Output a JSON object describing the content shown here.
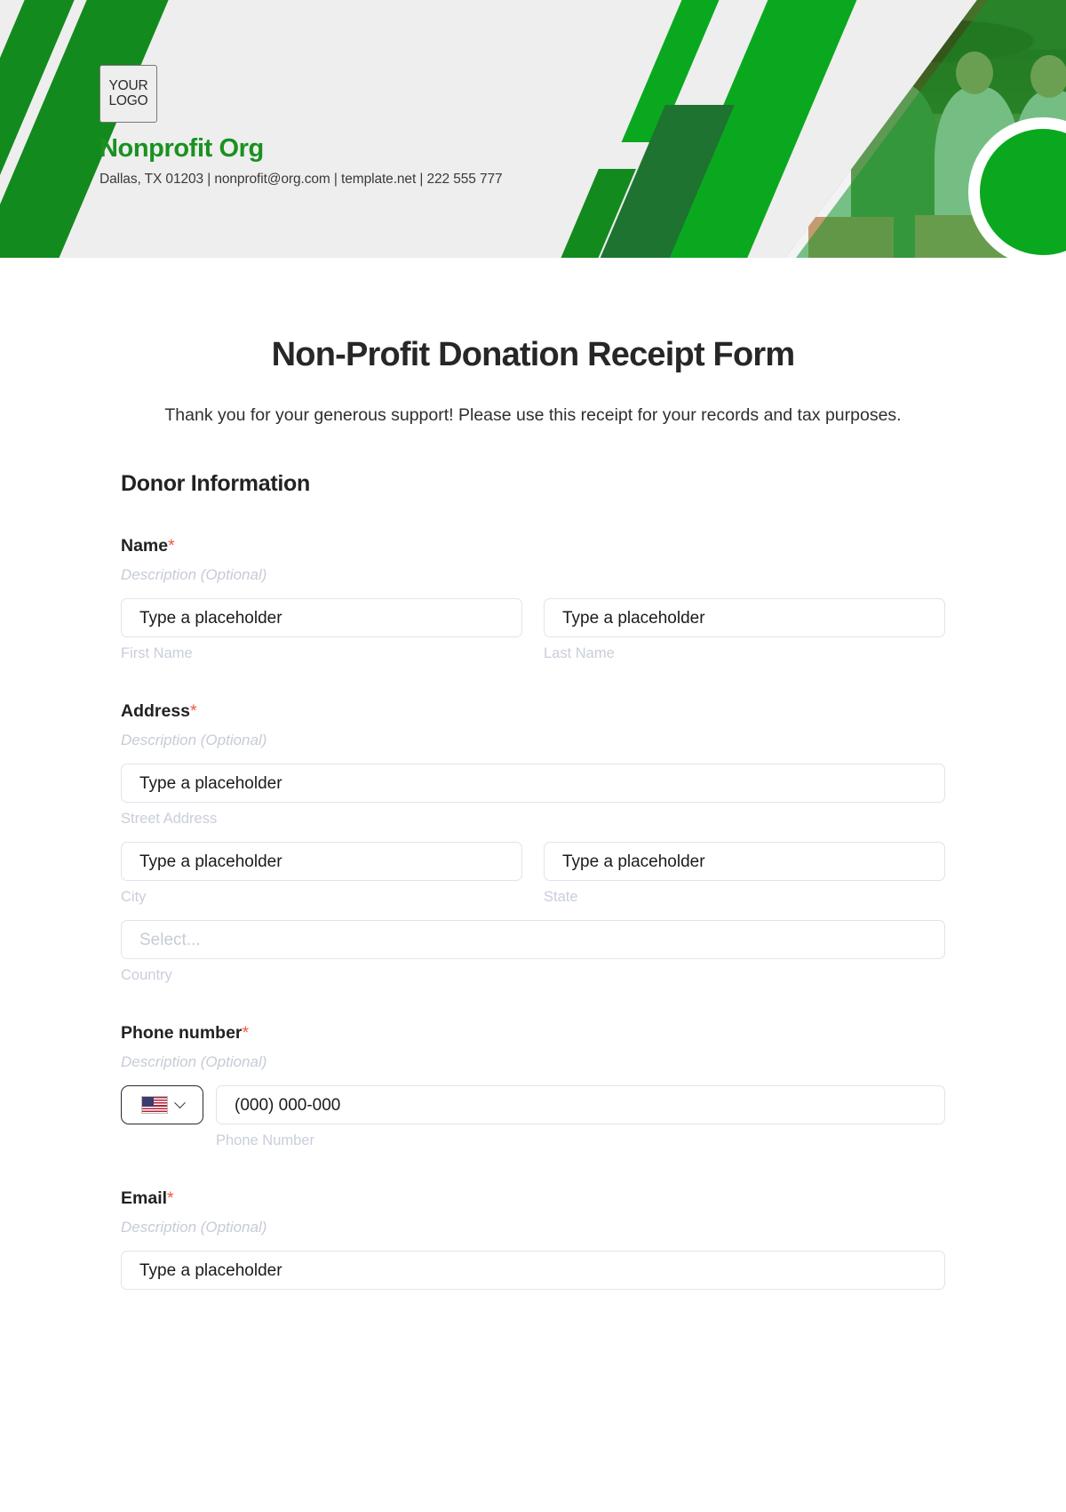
{
  "header": {
    "logo_line1": "YOUR",
    "logo_line2": "LOGO",
    "org_name": "Nonprofit Org",
    "org_meta": "Dallas, TX 01203 | nonprofit@org.com | template.net | 222 555 777",
    "accent_green": "#0aa81e",
    "dark_green": "#138a1d",
    "deep_green": "#1e7330",
    "bg": "#eeeeee"
  },
  "form": {
    "title": "Non-Profit Donation Receipt Form",
    "subtitle": "Thank you for your generous support! Please use this receipt for your records and tax purposes.",
    "section_title": "Donor Information",
    "required_marker": "*",
    "description_placeholder": "Description (Optional)",
    "fields": [
      {
        "label": "Name",
        "required": true,
        "description": "Description (Optional)",
        "inputs": [
          {
            "placeholder": "Type a placeholder",
            "sublabel": "First Name"
          },
          {
            "placeholder": "Type a placeholder",
            "sublabel": "Last Name"
          }
        ]
      },
      {
        "label": "Address",
        "required": true,
        "description": "Description (Optional)",
        "inputs": [
          {
            "placeholder": "Type a placeholder",
            "sublabel": "Street Address"
          },
          {
            "placeholder": "Type a placeholder",
            "sublabel": "City"
          },
          {
            "placeholder": "Type a placeholder",
            "sublabel": "State"
          },
          {
            "placeholder": "Select...",
            "sublabel": "Country"
          }
        ]
      },
      {
        "label": "Phone number",
        "required": true,
        "description": "Description (Optional)",
        "country_code_icon": "us-flag-icon",
        "inputs": [
          {
            "placeholder": "(000) 000-000",
            "sublabel": "Phone Number"
          }
        ]
      },
      {
        "label": "Email",
        "required": true,
        "description": "Description (Optional)",
        "inputs": [
          {
            "placeholder": "Type a placeholder",
            "sublabel": ""
          }
        ]
      }
    ]
  }
}
